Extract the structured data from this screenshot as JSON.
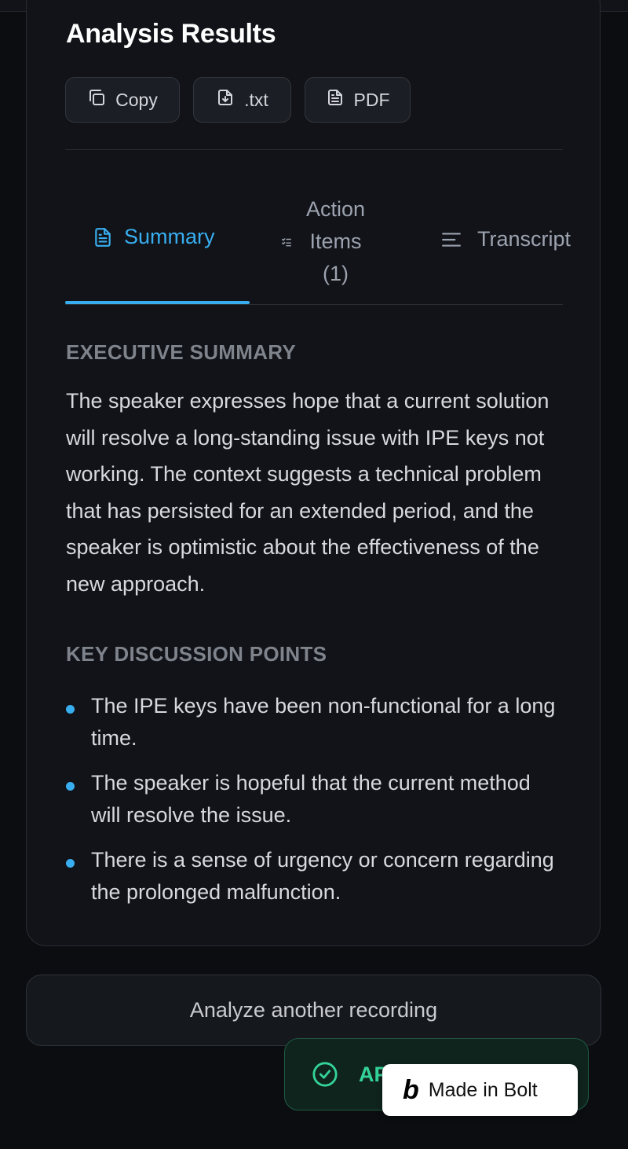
{
  "page": {
    "title": "Analysis Results"
  },
  "toolbar": {
    "copy_label": "Copy",
    "txt_label": ".txt",
    "pdf_label": "PDF"
  },
  "tabs": [
    {
      "label": "Summary",
      "active": true
    },
    {
      "label_line1": "Action",
      "label_line2": "Items",
      "label_line3": "(1)",
      "active": false
    },
    {
      "label": "Transcript",
      "active": false
    }
  ],
  "summary": {
    "executive_heading": "EXECUTIVE SUMMARY",
    "executive_text": "The speaker expresses hope that a current solution will resolve a long-standing issue with IPE keys not working. The context suggests a technical problem that has persisted for an extended period, and the speaker is optimistic about the effectiveness of the new approach.",
    "key_points_heading": "KEY DISCUSSION POINTS",
    "key_points": [
      "The IPE keys have been non-functional for a long time.",
      "The speaker is hopeful that the current method will resolve the issue.",
      "There is a sense of urgency or concern regarding the prolonged malfunction."
    ]
  },
  "actions": {
    "analyze_another_label": "Analyze another recording"
  },
  "toast": {
    "text": "AP",
    "icon": "check-circle-icon"
  },
  "badge": {
    "logo": "b",
    "label": "Made in Bolt"
  },
  "colors": {
    "accent": "#38aef0",
    "success": "#34d399",
    "background": "#0b0d11",
    "card": "#111318"
  }
}
